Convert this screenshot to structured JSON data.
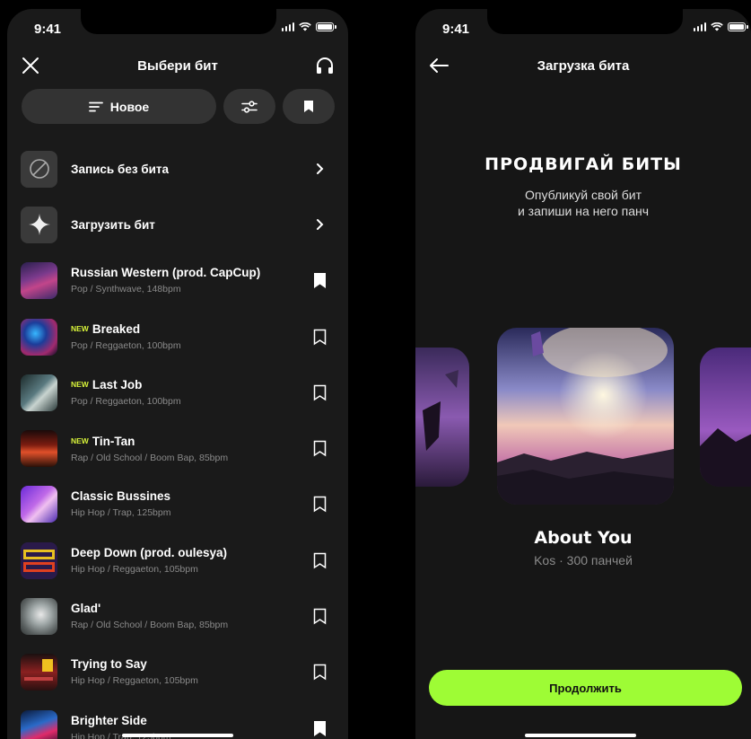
{
  "colors": {
    "accent": "#9efc35",
    "new_badge": "#d7f23a",
    "pill_bg": "#333333",
    "bg": "#1a1a1a"
  },
  "left_screen": {
    "status_time": "9:41",
    "title": "Выбери бит",
    "left_icon": "close-icon",
    "right_icon": "headphones-icon",
    "sort_label": "Новое",
    "filter_icon": "sliders-icon",
    "saved_icon": "bookmark-icon",
    "actions": [
      {
        "label": "Запись без бита",
        "icon": "no-beat-icon"
      },
      {
        "label": "Загрузить бит",
        "icon": "sparkle-icon"
      }
    ],
    "new_label": "NEW",
    "beats": [
      {
        "title": "Russian Western (prod. CapCup)",
        "meta": "Pop / Synthwave, 148bpm",
        "is_new": false,
        "bookmarked": true
      },
      {
        "title": "Breaked",
        "meta": "Pop / Reggaeton, 100bpm",
        "is_new": true,
        "bookmarked": false
      },
      {
        "title": "Last Job",
        "meta": "Pop / Reggaeton, 100bpm",
        "is_new": true,
        "bookmarked": false
      },
      {
        "title": "Tin-Tan",
        "meta": "Rap / Old School / Boom Bap, 85bpm",
        "is_new": true,
        "bookmarked": false
      },
      {
        "title": "Classic Bussines",
        "meta": "Hip Hop / Trap, 125bpm",
        "is_new": false,
        "bookmarked": false
      },
      {
        "title": "Deep Down (prod. oulesya)",
        "meta": "Hip Hop / Reggaeton, 105bpm",
        "is_new": false,
        "bookmarked": false
      },
      {
        "title": "Glad'",
        "meta": "Rap / Old School / Boom Bap, 85bpm",
        "is_new": false,
        "bookmarked": false
      },
      {
        "title": "Trying to Say",
        "meta": "Hip Hop / Reggaeton, 105bpm",
        "is_new": false,
        "bookmarked": false
      },
      {
        "title": "Brighter Side",
        "meta": "Hip Hop / Trap, 125bpm",
        "is_new": false,
        "bookmarked": true
      }
    ]
  },
  "right_screen": {
    "status_time": "9:41",
    "title": "Загрузка бита",
    "back_icon": "arrow-left-icon",
    "promo_title": "ПРОДВИГАЙ БИТЫ",
    "promo_line1": "Опубликуй свой бит",
    "promo_line2": "и запиши на него панч",
    "beat_name": "About You",
    "beat_meta": "Kos · 300 панчей",
    "continue_label": "Продолжить"
  }
}
